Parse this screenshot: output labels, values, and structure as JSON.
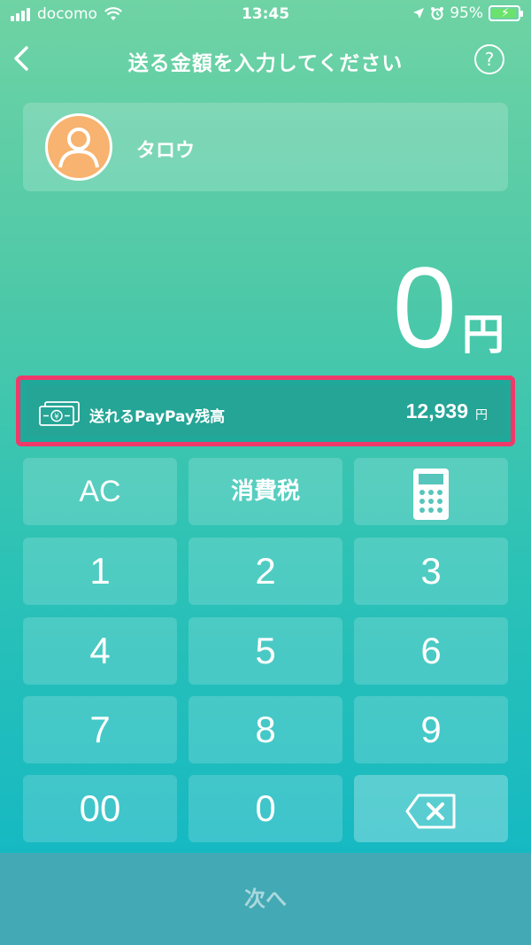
{
  "status_bar": {
    "carrier": "docomo",
    "time": "13:45",
    "battery": "95%"
  },
  "nav": {
    "title": "送る金額を入力してください",
    "help": "?"
  },
  "recipient": {
    "name": "タロウ"
  },
  "amount": {
    "value": "0",
    "unit": "円"
  },
  "balance": {
    "label": "送れるPayPay残高",
    "amount": "12,939",
    "unit": "円"
  },
  "keypad": {
    "row1": [
      "AC",
      "消費税"
    ],
    "digits": [
      "1",
      "2",
      "3",
      "4",
      "5",
      "6",
      "7",
      "8",
      "9",
      "00",
      "0"
    ]
  },
  "next_label": "次へ",
  "colors": {
    "highlight": "#f0386a",
    "avatar": "#f7b36f"
  }
}
